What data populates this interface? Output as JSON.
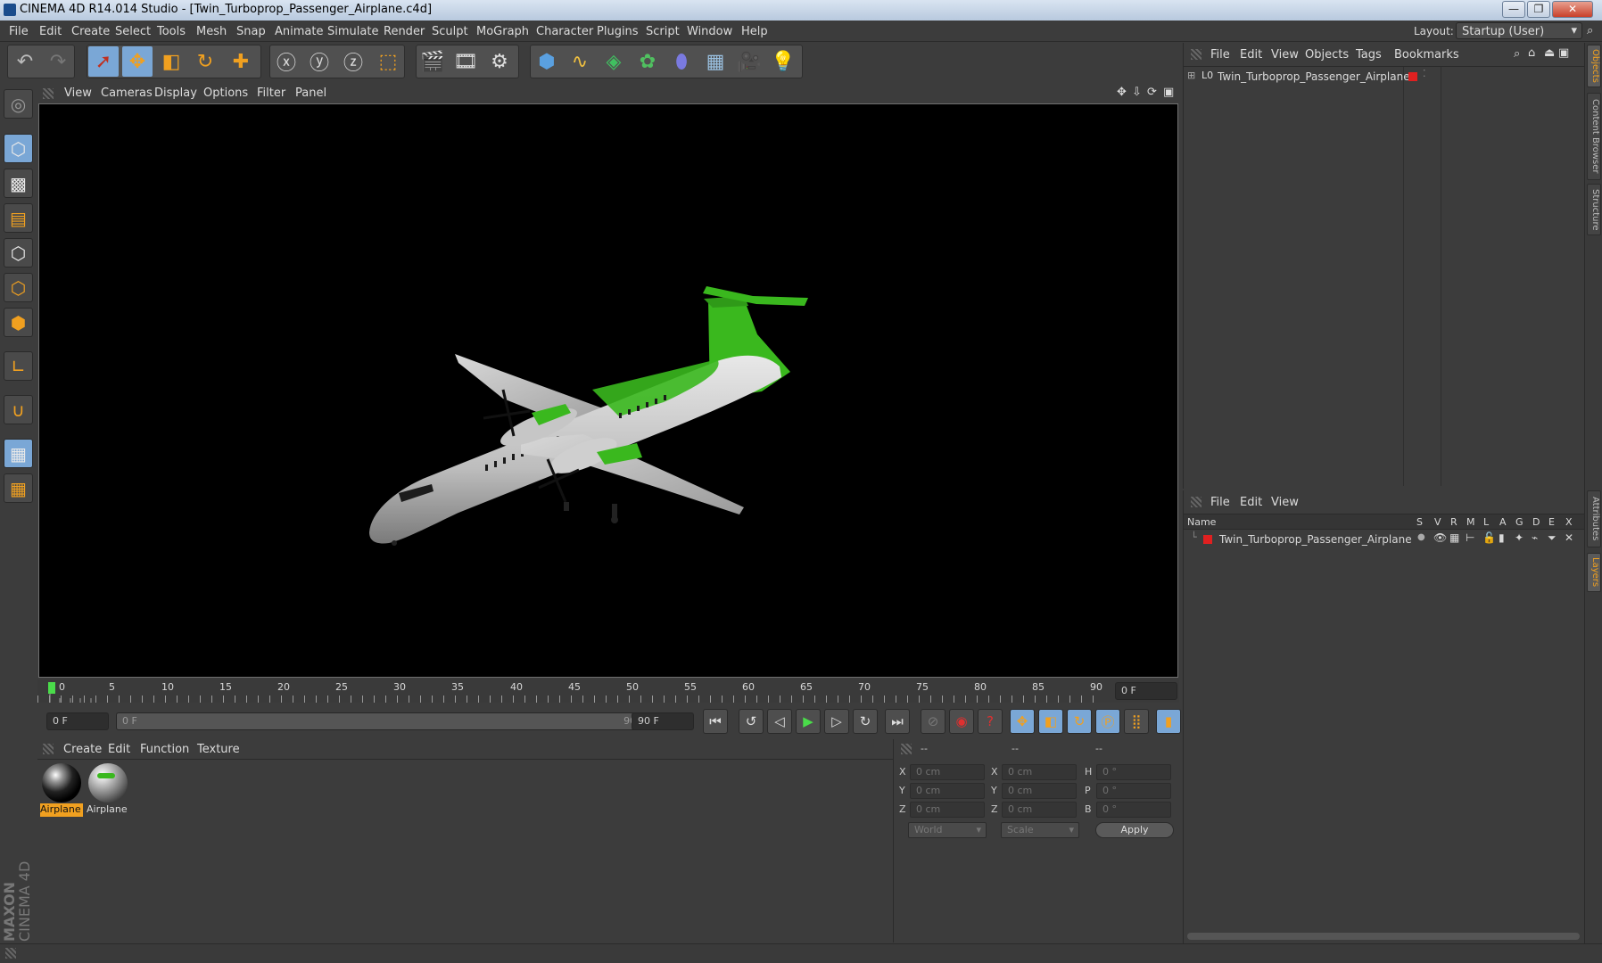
{
  "window": {
    "title": "CINEMA 4D R14.014 Studio - [Twin_Turboprop_Passenger_Airplane.c4d]",
    "buttons": {
      "minimize": "—",
      "maximize": "❐",
      "close": "✕"
    }
  },
  "menubar": {
    "items": [
      "File",
      "Edit",
      "Create",
      "Select",
      "Tools",
      "Mesh",
      "Snap",
      "Animate",
      "Simulate",
      "Render",
      "Sculpt",
      "MoGraph",
      "Character",
      "Plugins",
      "Script",
      "Window",
      "Help"
    ],
    "layout_label": "Layout:",
    "layout_value": "Startup (User)"
  },
  "viewport": {
    "menu": [
      "View",
      "Cameras",
      "Display",
      "Options",
      "Filter",
      "Panel"
    ]
  },
  "timeline": {
    "ticks": [
      "0",
      "5",
      "10",
      "15",
      "20",
      "25",
      "30",
      "35",
      "40",
      "45",
      "50",
      "55",
      "60",
      "65",
      "70",
      "75",
      "80",
      "85",
      "90"
    ],
    "current_frame": "0 F"
  },
  "transport": {
    "start_field": "0 F",
    "range_start": "0 F",
    "range_end": "90 F",
    "end_field": "90 F"
  },
  "materials": {
    "menu": [
      "Create",
      "Edit",
      "Function",
      "Texture"
    ],
    "items": [
      {
        "label": "Airplane",
        "selected": true
      },
      {
        "label": "Airplane",
        "selected": false
      }
    ]
  },
  "coordinates": {
    "headers": [
      "--",
      "--",
      "--"
    ],
    "rows": [
      {
        "axis1": "X",
        "val1": "0 cm",
        "axis2": "X",
        "val2": "0 cm",
        "axis3": "H",
        "val3": "0 °"
      },
      {
        "axis1": "Y",
        "val1": "0 cm",
        "axis2": "Y",
        "val2": "0 cm",
        "axis3": "P",
        "val3": "0 °"
      },
      {
        "axis1": "Z",
        "val1": "0 cm",
        "axis2": "Z",
        "val2": "0 cm",
        "axis3": "B",
        "val3": "0 °"
      }
    ],
    "world_select": "World",
    "scale_select": "Scale",
    "apply_label": "Apply"
  },
  "objects_panel": {
    "menu": [
      "File",
      "Edit",
      "View",
      "Objects",
      "Tags",
      "Bookmarks"
    ],
    "object_name": "Twin_Turboprop_Passenger_Airplane",
    "layer_color": "#e02020"
  },
  "layers_panel": {
    "menu": [
      "File",
      "Edit",
      "View"
    ],
    "columns": [
      "Name",
      "S",
      "V",
      "R",
      "M",
      "L",
      "A",
      "G",
      "D",
      "E",
      "X"
    ],
    "row_name": "Twin_Turboprop_Passenger_Airplane"
  },
  "side_tabs": [
    "Objects",
    "Content Browser",
    "Structure",
    "Attributes",
    "Layers"
  ],
  "branding": {
    "maxon": "MAXON",
    "product": "CINEMA 4D"
  },
  "colors": {
    "accent": "#f0a020",
    "highlight_blue": "#7aa7d6",
    "plane_green": "#3ab81e"
  }
}
